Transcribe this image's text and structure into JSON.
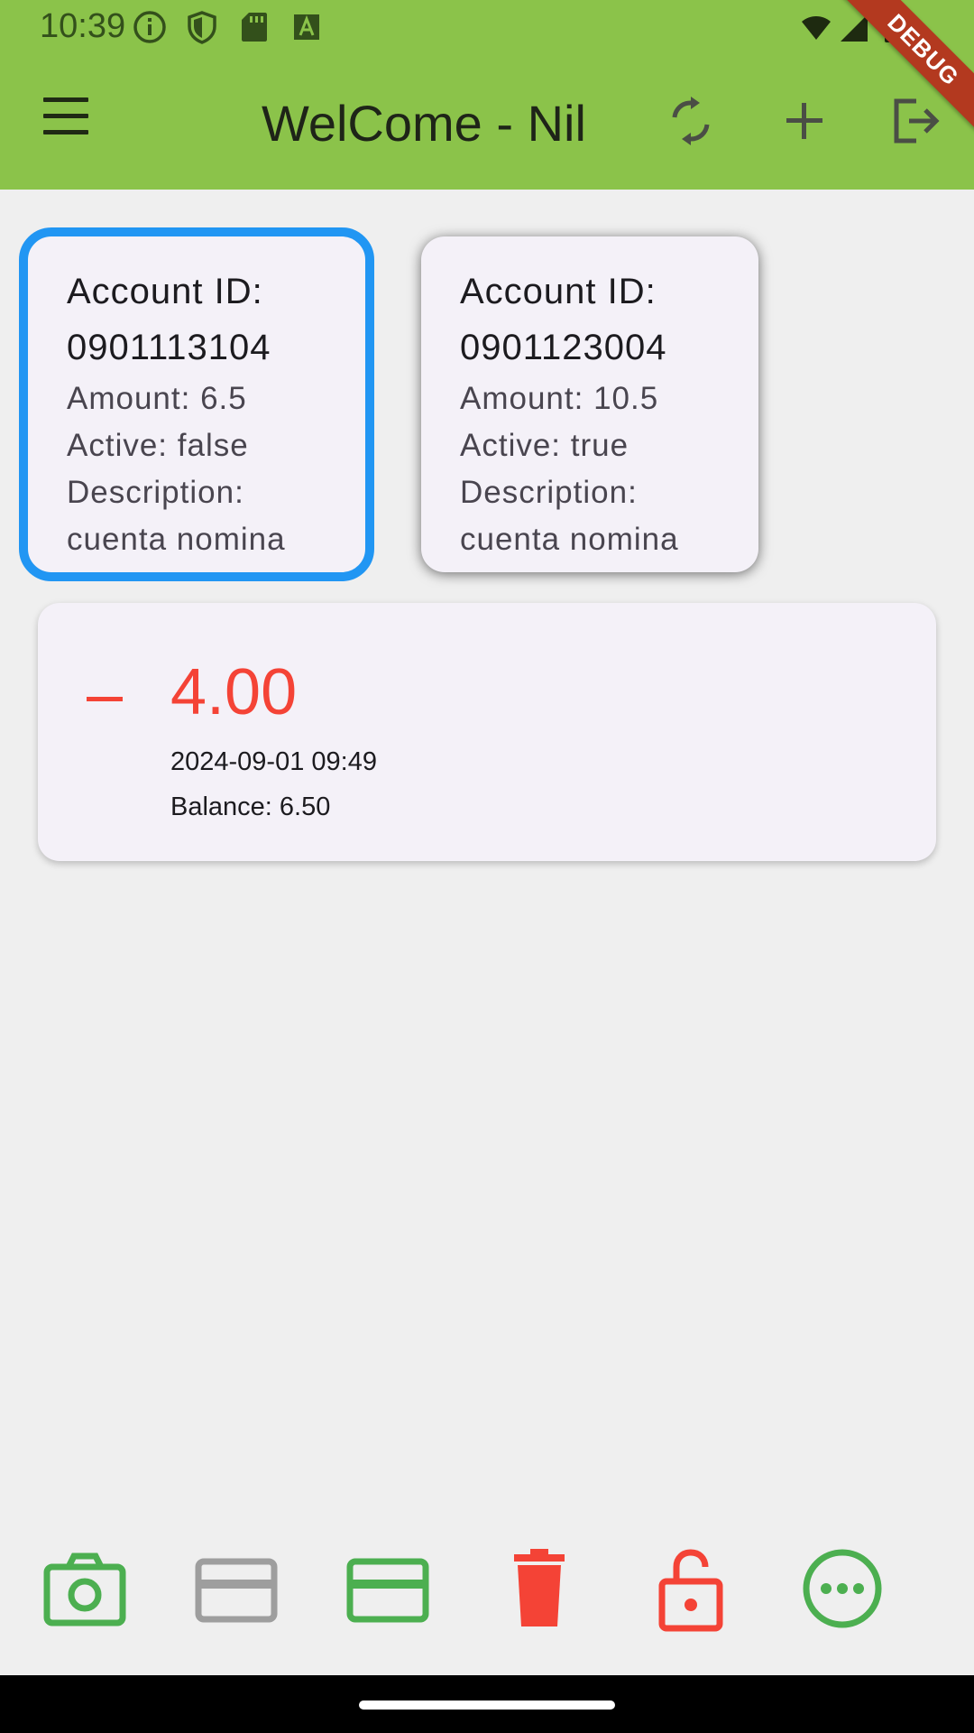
{
  "status_bar": {
    "time": "10:39",
    "left_icons": [
      "info-icon",
      "shield-icon",
      "sd-card-icon",
      "text-a-icon"
    ],
    "right_icons": [
      "wifi-icon",
      "signal-icon",
      "battery-icon"
    ]
  },
  "debug_banner": "DEBUG",
  "appbar": {
    "title": "WelCome - Nil",
    "background": "#8bc34a",
    "actions": [
      "refresh-icon",
      "add-icon",
      "logout-icon"
    ]
  },
  "accounts": [
    {
      "account_label": "Account ID:",
      "account_id": "0901113104",
      "amount": "Amount: 6.5",
      "active": "Active: false",
      "description_label": "Description:",
      "description": "cuenta nomina",
      "selected": true
    },
    {
      "account_label": "Account ID:",
      "account_id": "0901123004",
      "amount": "Amount: 10.5",
      "active": "Active: true",
      "description_label": "Description:",
      "description": "cuenta nomina",
      "selected": false
    }
  ],
  "transaction": {
    "sign": "−",
    "amount": "4.00",
    "datetime": "2024-09-01 09:49",
    "balance": "Balance: 6.50",
    "color": "#f44336"
  },
  "bottom_actions": [
    {
      "icon": "camera-icon",
      "color": "#4caf50"
    },
    {
      "icon": "credit-card-icon",
      "color": "#9e9e9e"
    },
    {
      "icon": "credit-card-icon",
      "color": "#4caf50"
    },
    {
      "icon": "trash-icon",
      "color": "#f44336"
    },
    {
      "icon": "unlock-icon",
      "color": "#f44336"
    },
    {
      "icon": "more-horizontal-icon",
      "color": "#4caf50"
    }
  ],
  "selected_color": "#2196f3"
}
